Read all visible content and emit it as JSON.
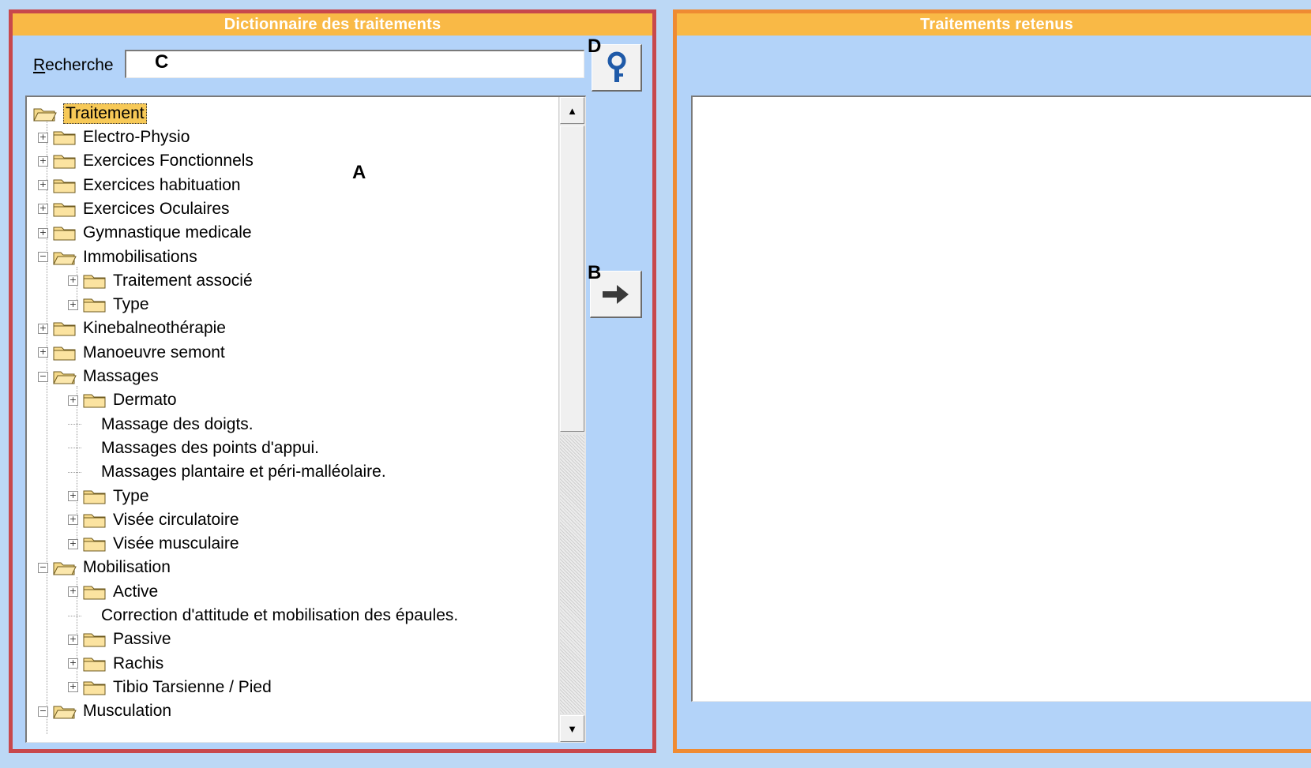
{
  "left_panel": {
    "title": "Dictionnaire des traitements"
  },
  "right_panel": {
    "title": "Traitements retenus"
  },
  "search": {
    "label_first": "R",
    "label_rest": "echerche",
    "value": ""
  },
  "markers": {
    "a": "A",
    "b": "B",
    "c": "C",
    "d": "D"
  },
  "tree": {
    "root": "Traitement",
    "items": [
      "Electro-Physio",
      "Exercices Fonctionnels",
      "Exercices habituation",
      "Exercices Oculaires",
      "Gymnastique medicale",
      "Immobilisations",
      "Traitement associé",
      "Type",
      "Kinebalneothérapie",
      "Manoeuvre semont",
      "Massages",
      "Dermato",
      "Massage des doigts.",
      "Massages des points d'appui.",
      "Massages plantaire et péri-malléolaire.",
      "Type",
      "Visée circulatoire",
      "Visée musculaire",
      "Mobilisation",
      "Active",
      "Correction d'attitude et mobilisation des épaules.",
      "Passive",
      "Rachis",
      "Tibio Tarsienne / Pied",
      "Musculation"
    ]
  },
  "colors": {
    "left_border": "#c8484c",
    "right_border": "#ef8b32",
    "header": "#f9b946",
    "panel_bg": "#b3d3f9"
  },
  "icons": {
    "search_button": "key-icon",
    "add_button": "arrow-right-icon"
  }
}
